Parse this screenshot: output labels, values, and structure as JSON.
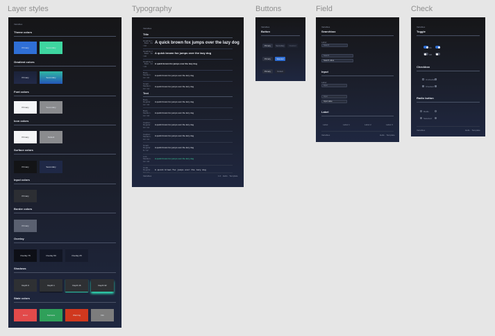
{
  "frames": {
    "layer_styles": "Layer styles",
    "typography": "Typography",
    "buttons": "Buttons",
    "field": "Field",
    "check": "Check"
  },
  "frame_header": "Variables",
  "colors": {
    "primary": "#2f6fd6",
    "secondary": "#3ed6a0",
    "teal_glow": "#2fd6b0",
    "error": "#e24a4a",
    "success": "#2fa05a",
    "warning": "#d0381e",
    "info": "#7d7d7d"
  },
  "layer": {
    "theme_colors": "Theme colors",
    "theme": [
      "Primary",
      "Secondary"
    ],
    "gradient_colors": "Gradient colors",
    "gradient": [
      "Primary",
      "Secondary"
    ],
    "font_colors": "Font colors",
    "font": [
      "Primary",
      "Secondary"
    ],
    "icon_colors": "Icon colors",
    "icon": [
      "Primary",
      "Default"
    ],
    "surface_colors": "Surface colors",
    "surface": [
      "Primary",
      "Secondary"
    ],
    "input_colors": "Input colors",
    "input": [
      "Primary"
    ],
    "border_colors": "Border colors",
    "border": [
      "Primary"
    ],
    "overlay": "Overlay",
    "overlays": [
      "Overlay 75",
      "Overlay 50",
      "Overlay 25"
    ],
    "shadows": "Shadows",
    "shadow_items": [
      "Depth 0",
      "Depth 1",
      "Depth 16",
      "Depth 32"
    ],
    "state_colors": "State colors",
    "states": [
      "Error",
      "Success",
      "Warning",
      "Info"
    ]
  },
  "typography": {
    "title": "Title",
    "text": "Text",
    "sample": "A quick brown fox jumps over the lazy dog",
    "footer_left": "Variables",
    "footer_right": "1.0 · Hello · Template",
    "title_rows": [
      {
        "meta": "Heading 1 · Bold · 24 / 32"
      },
      {
        "meta": "Heading 2 · Bold · 16 / 20"
      },
      {
        "meta": "Heading 3 · Bold · 14 / 16"
      },
      {
        "meta": "Body · Medium · 12 / 16"
      },
      {
        "meta": "Small · Medium · 10 / 12"
      }
    ],
    "text_rows": [
      {
        "meta": "Body · Regular · 12 / 16"
      },
      {
        "meta": "Body · Medium · 12 / 16"
      },
      {
        "meta": "Caption · Regular · 10 / 12"
      },
      {
        "meta": "Caption · Medium · 10 / 12"
      },
      {
        "meta": "Small · Regular · 8 / 12"
      },
      {
        "meta": "Link · Medium · 12 / 16"
      },
      {
        "meta": "Code · Regular · 10 / 12"
      }
    ]
  },
  "buttons": {
    "section": "Button",
    "row1": [
      "Primary",
      "Secondary",
      "Disabled"
    ],
    "row2": [
      "Primary",
      "Selected"
    ],
    "row3": [
      "Primary",
      "Default"
    ]
  },
  "field": {
    "searchbox": "Searchbox",
    "label_small": "Label",
    "search_placeholder": "Search",
    "search_value": "Search value",
    "input": "Input",
    "input_placeholder": "Input",
    "input_value": "Input value",
    "label": "Label",
    "labels_row": [
      "Label",
      "Label 1",
      "Label 2",
      "Label 3"
    ],
    "footer_left": "Variables",
    "footer_right": "Hello · Template"
  },
  "check": {
    "toggle": "Toggle",
    "toggle_on": "On",
    "toggle_off": "Off",
    "checkbox": "Checkbox",
    "checkbox_items": [
      "Unchecked",
      "Checked"
    ],
    "radio": "Radio button",
    "radio_items": [
      "Radio",
      "Selected"
    ],
    "footer_left": "Variables",
    "footer_right": "Hello · Template"
  }
}
